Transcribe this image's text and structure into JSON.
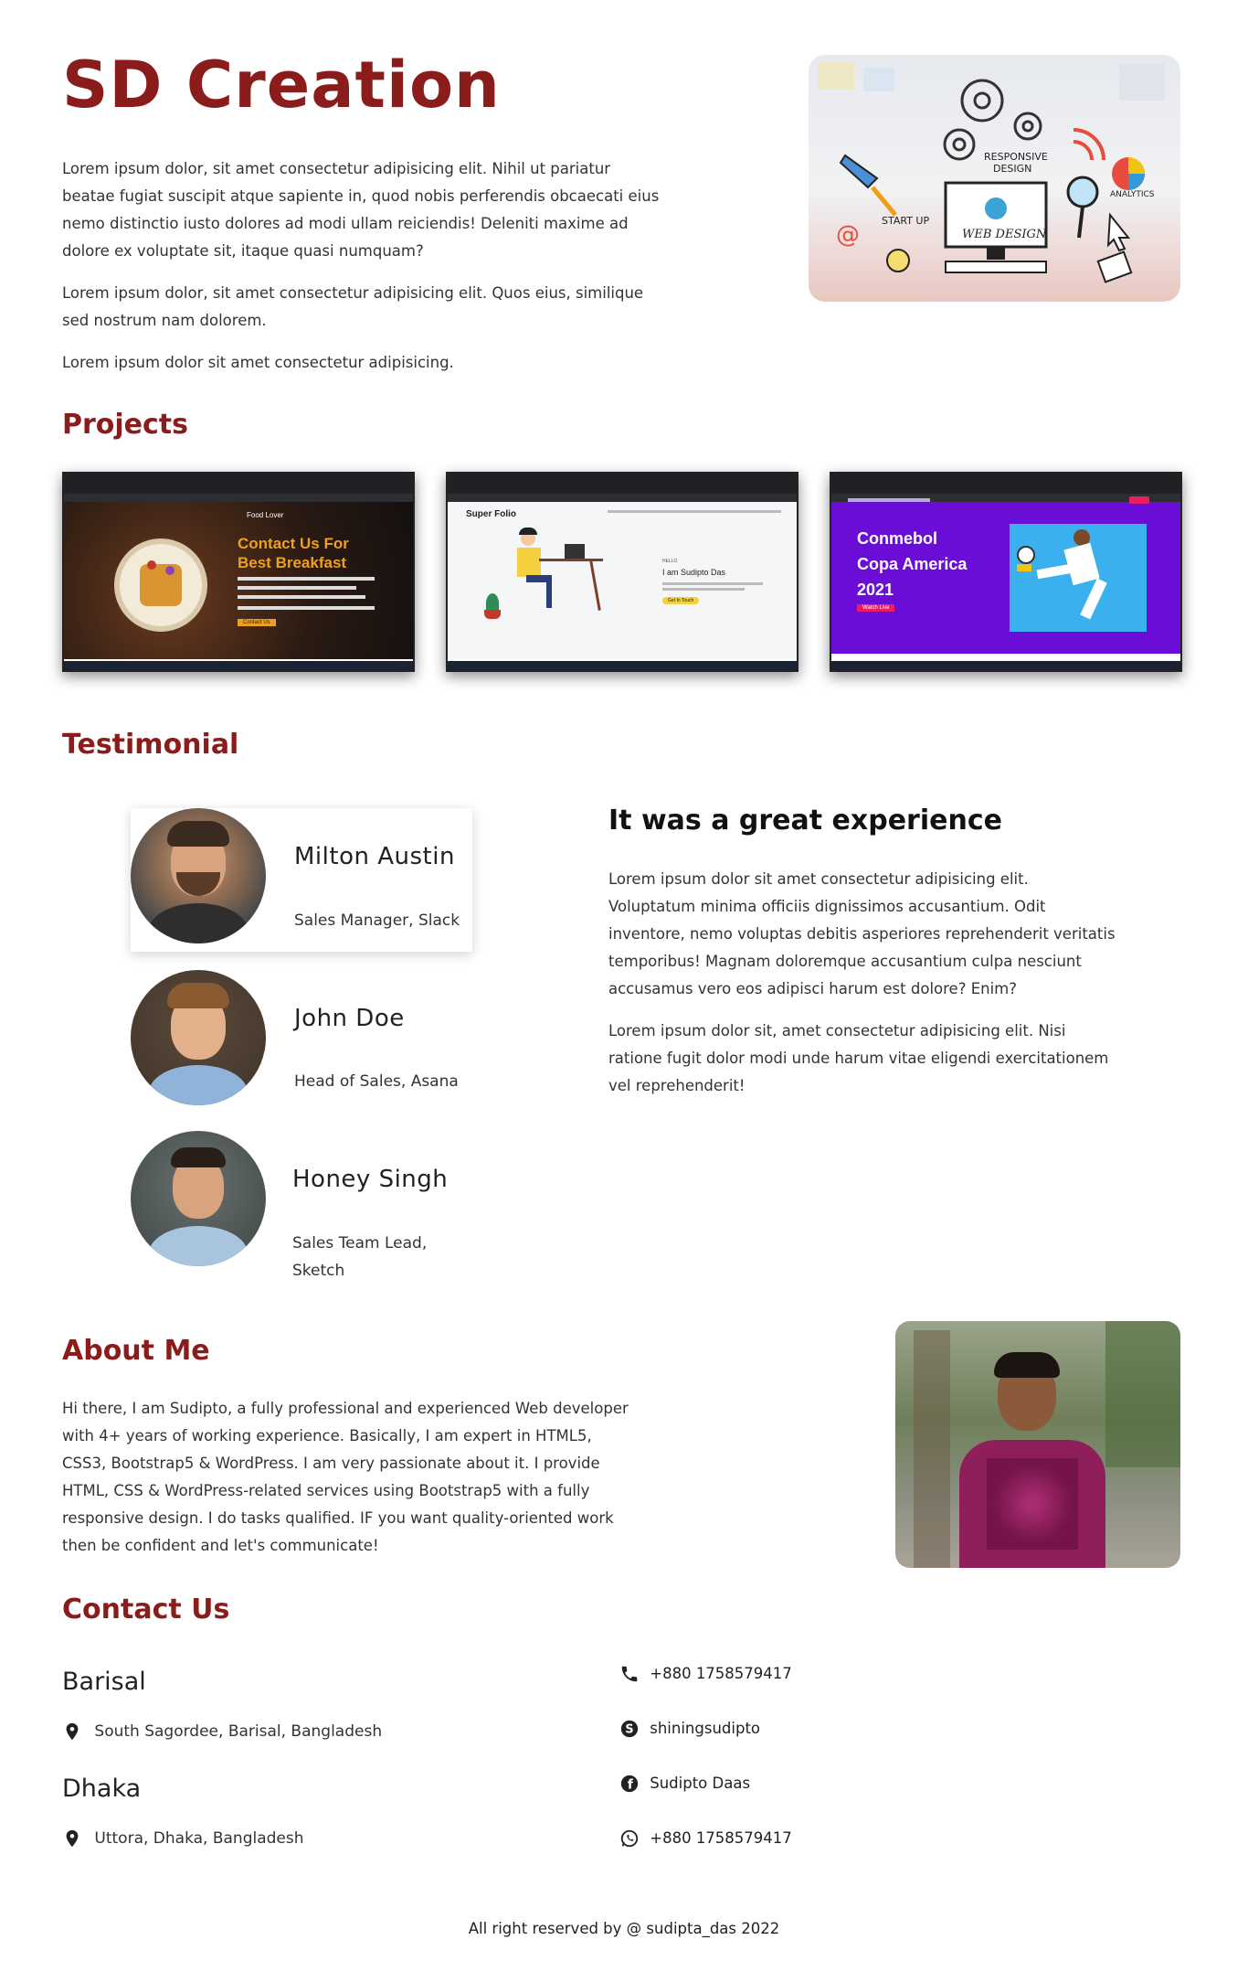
{
  "hero": {
    "title": "SD Creation",
    "paragraphs": [
      "Lorem ipsum dolor, sit amet consectetur adipisicing elit. Nihil ut pariatur beatae fugiat suscipit atque sapiente in, quod nobis perferendis obcaecati eius nemo distinctio iusto dolores ad modi ullam reiciendis! Deleniti maxime ad dolore ex voluptate sit, itaque quasi numquam?",
      "Lorem ipsum dolor, sit amet consectetur adipisicing elit. Quos eius, similique sed nostrum nam dolorem.",
      "Lorem ipsum dolor sit amet consectetur adipisicing."
    ],
    "image_labels": [
      "Responsive Design",
      "Analytics",
      "Start up",
      "Web Design"
    ]
  },
  "projects": {
    "heading": "Projects",
    "items": [
      {
        "title_line1": "Contact Us For",
        "title_line2": "Best Breakfast",
        "button": "Contact Us",
        "logo": "Food Lover"
      },
      {
        "brand": "Super Folio",
        "hello": "HELLO",
        "name": "I am Sudipto Das",
        "button": "Get In Touch"
      },
      {
        "title_line1": "Conmebol",
        "title_line2": "Copa America",
        "title_line3": "2021",
        "button": "Watch Live"
      }
    ]
  },
  "testimonial": {
    "heading": "Testimonial",
    "people": [
      {
        "name": "Milton Austin",
        "role": "Sales Manager, Slack"
      },
      {
        "name": "John Doe",
        "role": "Head of Sales, Asana"
      },
      {
        "name": "Honey Singh",
        "role_line1": "Sales Team Lead,",
        "role_line2": "Sketch"
      }
    ],
    "quote_title": "It was a great experience",
    "quote_paragraphs": [
      "Lorem ipsum dolor sit amet consectetur adipisicing elit. Voluptatum minima officiis dignissimos accusantium. Odit inventore, nemo voluptas debitis asperiores reprehenderit veritatis temporibus! Magnam doloremque accusantium culpa nesciunt accusamus vero eos adipisci harum est dolore? Enim?",
      "Lorem ipsum dolor sit, amet consectetur adipisicing elit. Nisi ratione fugit dolor modi unde harum vitae eligendi exercitationem vel reprehenderit!"
    ]
  },
  "about": {
    "heading": "About Me",
    "text": "Hi there, I am Sudipto, a fully professional and experienced Web developer with 4+ years of working experience. Basically, I am expert in HTML5, CSS3, Bootstrap5 & WordPress. I am very passionate about it. I provide HTML, CSS & WordPress-related services using Bootstrap5 with a fully responsive design. I do tasks qualified. IF you want quality-oriented work then be confident and let's communicate!"
  },
  "contact": {
    "heading": "Contact Us",
    "locations": [
      {
        "city": "Barisal",
        "address": "South Sagordee, Barisal, Bangladesh"
      },
      {
        "city": "Dhaka",
        "address": "Uttora, Dhaka, Bangladesh"
      }
    ],
    "channels": [
      {
        "icon": "phone-icon",
        "text": "+880 1758579417"
      },
      {
        "icon": "skype-icon",
        "text": "shiningsudipto"
      },
      {
        "icon": "facebook-icon",
        "text": "Sudipto Daas"
      },
      {
        "icon": "whatsapp-icon",
        "text": "+880 1758579417"
      }
    ]
  },
  "footer": {
    "text": "All right reserved by @ sudipta_das 2022"
  },
  "colors": {
    "brand": "#8a1c1c",
    "text": "#222222",
    "purple": "#6a0dd6",
    "orange": "#f0a020"
  }
}
